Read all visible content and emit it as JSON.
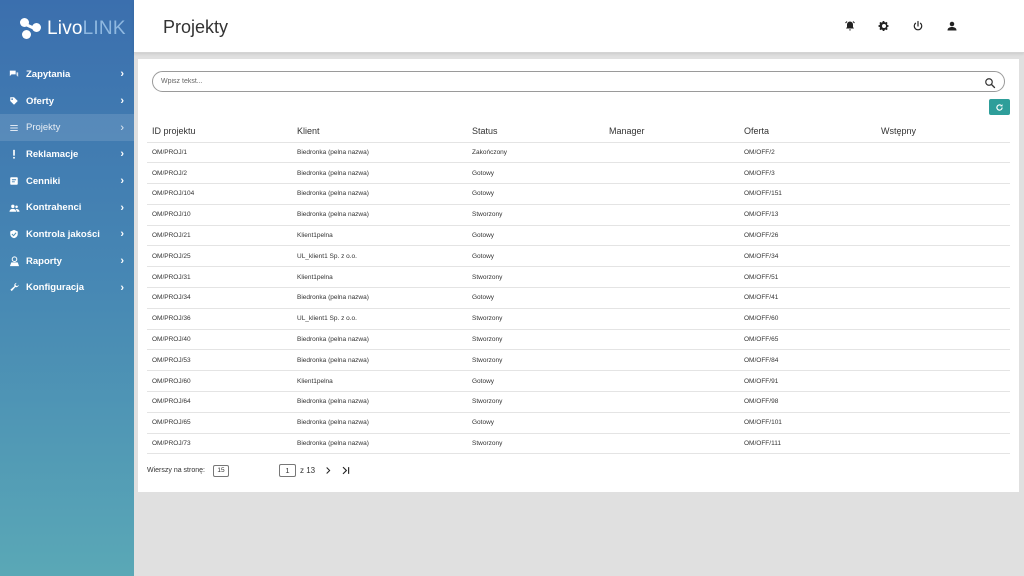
{
  "brand": {
    "part1": "Livo",
    "part2": "LINK"
  },
  "sidebar": {
    "items": [
      {
        "label": "Zapytania",
        "icon": "chat-icon"
      },
      {
        "label": "Oferty",
        "icon": "tag-icon"
      },
      {
        "label": "Projekty",
        "icon": "list-icon",
        "active": true
      },
      {
        "label": "Reklamacje",
        "icon": "exclamation-icon"
      },
      {
        "label": "Cenniki",
        "icon": "price-list-icon"
      },
      {
        "label": "Kontrahenci",
        "icon": "people-icon"
      },
      {
        "label": "Kontrola jakości",
        "icon": "shield-check-icon"
      },
      {
        "label": "Raporty",
        "icon": "report-icon"
      },
      {
        "label": "Konfiguracja",
        "icon": "wrench-icon"
      }
    ]
  },
  "header": {
    "title": "Projekty",
    "icons": [
      "alarm-icon",
      "gear-icon",
      "power-icon",
      "user-icon"
    ]
  },
  "search": {
    "placeholder": "Wpisz tekst..."
  },
  "table": {
    "columns": [
      "ID projektu",
      "Klient",
      "Status",
      "Manager",
      "Oferta",
      "Wstępny"
    ],
    "rows": [
      [
        "OM/PROJ/1",
        "Biedronka (pelna nazwa)",
        "Zakończony",
        "",
        "OM/OFF/2",
        ""
      ],
      [
        "OM/PROJ/2",
        "Biedronka (pelna nazwa)",
        "Gotowy",
        "",
        "OM/OFF/3",
        ""
      ],
      [
        "OM/PROJ/104",
        "Biedronka (pelna nazwa)",
        "Gotowy",
        "",
        "OM/OFF/151",
        ""
      ],
      [
        "OM/PROJ/10",
        "Biedronka (pelna nazwa)",
        "Stworzony",
        "",
        "OM/OFF/13",
        ""
      ],
      [
        "OM/PROJ/21",
        "Klient1pelna",
        "Gotowy",
        "",
        "OM/OFF/26",
        ""
      ],
      [
        "OM/PROJ/25",
        "UL_klient1 Sp. z o.o.",
        "Gotowy",
        "",
        "OM/OFF/34",
        ""
      ],
      [
        "OM/PROJ/31",
        "Klient1pelna",
        "Stworzony",
        "",
        "OM/OFF/51",
        ""
      ],
      [
        "OM/PROJ/34",
        "Biedronka (pelna nazwa)",
        "Gotowy",
        "",
        "OM/OFF/41",
        ""
      ],
      [
        "OM/PROJ/36",
        "UL_klient1 Sp. z o.o.",
        "Stworzony",
        "",
        "OM/OFF/60",
        ""
      ],
      [
        "OM/PROJ/40",
        "Biedronka (pelna nazwa)",
        "Stworzony",
        "",
        "OM/OFF/65",
        ""
      ],
      [
        "OM/PROJ/53",
        "Biedronka (pelna nazwa)",
        "Stworzony",
        "",
        "OM/OFF/84",
        ""
      ],
      [
        "OM/PROJ/60",
        "Klient1pelna",
        "Gotowy",
        "",
        "OM/OFF/91",
        ""
      ],
      [
        "OM/PROJ/64",
        "Biedronka (pelna nazwa)",
        "Stworzony",
        "",
        "OM/OFF/98",
        ""
      ],
      [
        "OM/PROJ/65",
        "Biedronka (pelna nazwa)",
        "Gotowy",
        "",
        "OM/OFF/101",
        ""
      ],
      [
        "OM/PROJ/73",
        "Biedronka (pelna nazwa)",
        "Stworzony",
        "",
        "OM/OFF/111",
        ""
      ]
    ]
  },
  "pager": {
    "rows_label": "Wierszy na stronę:",
    "rows_per_page": "15",
    "current_page": "1",
    "of_text": "z 13"
  },
  "colors": {
    "accent": "#2e9e9a",
    "sidebar_top": "#3b6fae",
    "sidebar_bottom": "#5aa8b6"
  }
}
